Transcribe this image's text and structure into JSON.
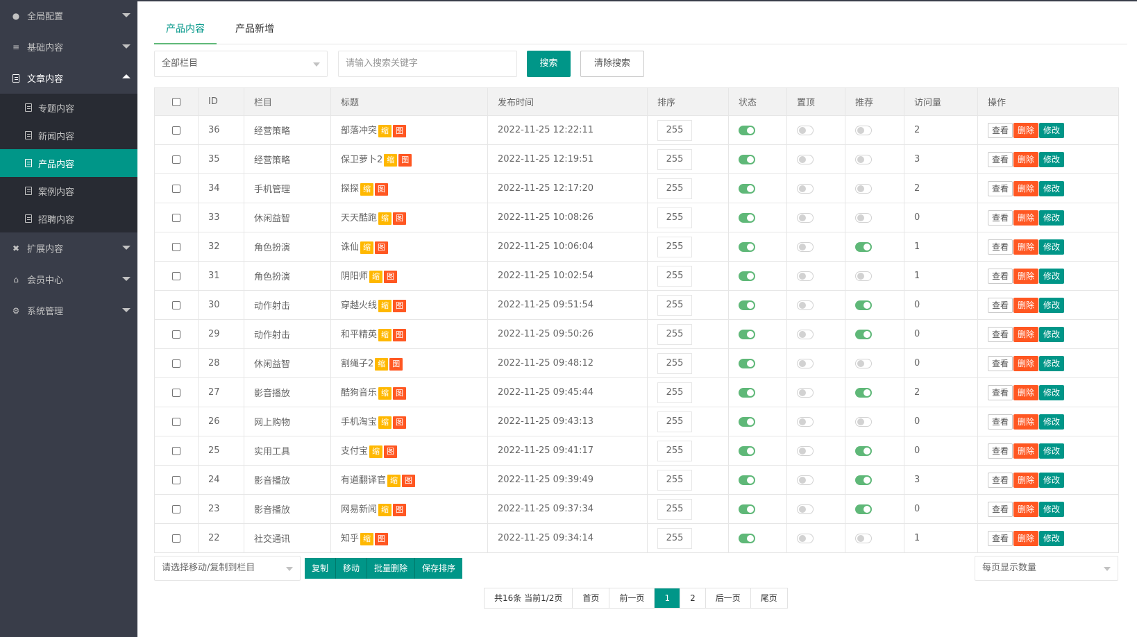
{
  "sidebar": {
    "items": [
      {
        "label": "全局配置",
        "icon": "globe-icon",
        "open": false
      },
      {
        "label": "基础内容",
        "icon": "sliders-icon",
        "open": false
      },
      {
        "label": "文章内容",
        "icon": "document-icon",
        "open": true
      },
      {
        "label": "扩展内容",
        "icon": "puzzle-icon",
        "open": false
      },
      {
        "label": "会员中心",
        "icon": "user-icon",
        "open": false
      },
      {
        "label": "系统管理",
        "icon": "gear-icon",
        "open": false
      }
    ],
    "sub_items": [
      {
        "label": "专题内容",
        "active": false
      },
      {
        "label": "新闻内容",
        "active": false
      },
      {
        "label": "产品内容",
        "active": true
      },
      {
        "label": "案例内容",
        "active": false
      },
      {
        "label": "招聘内容",
        "active": false
      }
    ]
  },
  "tabs": [
    {
      "label": "产品内容",
      "active": true
    },
    {
      "label": "产品新增",
      "active": false
    }
  ],
  "filter": {
    "category_select": "全部栏目",
    "search_placeholder": "请输入搜索关键字",
    "search_button": "搜索",
    "clear_button": "清除搜索"
  },
  "table": {
    "headers": [
      "ID",
      "栏目",
      "标题",
      "发布时间",
      "排序",
      "状态",
      "置顶",
      "推荐",
      "访问量",
      "操作"
    ],
    "tag_thumb": "缩",
    "tag_pic": "图",
    "action_view": "查看",
    "action_delete": "删除",
    "action_edit": "修改",
    "rows": [
      {
        "id": "36",
        "category": "经营策略",
        "title": "部落冲突",
        "time": "2022-11-25 12:22:11",
        "sort": "255",
        "status": true,
        "top": false,
        "recommend": false,
        "views": "2"
      },
      {
        "id": "35",
        "category": "经营策略",
        "title": "保卫萝卜2",
        "time": "2022-11-25 12:19:51",
        "sort": "255",
        "status": true,
        "top": false,
        "recommend": false,
        "views": "3"
      },
      {
        "id": "34",
        "category": "手机管理",
        "title": "探探",
        "time": "2022-11-25 12:17:20",
        "sort": "255",
        "status": true,
        "top": false,
        "recommend": false,
        "views": "2"
      },
      {
        "id": "33",
        "category": "休闲益智",
        "title": "天天酷跑",
        "time": "2022-11-25 10:08:26",
        "sort": "255",
        "status": true,
        "top": false,
        "recommend": false,
        "views": "0"
      },
      {
        "id": "32",
        "category": "角色扮演",
        "title": "诛仙",
        "time": "2022-11-25 10:06:04",
        "sort": "255",
        "status": true,
        "top": false,
        "recommend": true,
        "views": "1"
      },
      {
        "id": "31",
        "category": "角色扮演",
        "title": "阴阳师",
        "time": "2022-11-25 10:02:54",
        "sort": "255",
        "status": true,
        "top": false,
        "recommend": false,
        "views": "1"
      },
      {
        "id": "30",
        "category": "动作射击",
        "title": "穿越火线",
        "time": "2022-11-25 09:51:54",
        "sort": "255",
        "status": true,
        "top": false,
        "recommend": true,
        "views": "0"
      },
      {
        "id": "29",
        "category": "动作射击",
        "title": "和平精英",
        "time": "2022-11-25 09:50:26",
        "sort": "255",
        "status": true,
        "top": false,
        "recommend": true,
        "views": "0"
      },
      {
        "id": "28",
        "category": "休闲益智",
        "title": "割绳子2",
        "time": "2022-11-25 09:48:12",
        "sort": "255",
        "status": true,
        "top": false,
        "recommend": false,
        "views": "0"
      },
      {
        "id": "27",
        "category": "影音播放",
        "title": "酷狗音乐",
        "time": "2022-11-25 09:45:44",
        "sort": "255",
        "status": true,
        "top": false,
        "recommend": true,
        "views": "2"
      },
      {
        "id": "26",
        "category": "网上购物",
        "title": "手机淘宝",
        "time": "2022-11-25 09:43:13",
        "sort": "255",
        "status": true,
        "top": false,
        "recommend": false,
        "views": "0"
      },
      {
        "id": "25",
        "category": "实用工具",
        "title": "支付宝",
        "time": "2022-11-25 09:41:17",
        "sort": "255",
        "status": true,
        "top": false,
        "recommend": true,
        "views": "0"
      },
      {
        "id": "24",
        "category": "影音播放",
        "title": "有道翻译官",
        "time": "2022-11-25 09:39:49",
        "sort": "255",
        "status": true,
        "top": false,
        "recommend": true,
        "views": "3"
      },
      {
        "id": "23",
        "category": "影音播放",
        "title": "网易新闻",
        "time": "2022-11-25 09:37:34",
        "sort": "255",
        "status": true,
        "top": false,
        "recommend": true,
        "views": "0"
      },
      {
        "id": "22",
        "category": "社交通讯",
        "title": "知乎",
        "time": "2022-11-25 09:34:14",
        "sort": "255",
        "status": true,
        "top": false,
        "recommend": false,
        "views": "1"
      }
    ]
  },
  "bottom": {
    "move_select": "请选择移动/复制到栏目",
    "copy": "复制",
    "move": "移动",
    "batch_delete": "批量删除",
    "save_sort": "保存排序",
    "page_size_select": "每页显示数量"
  },
  "pager": {
    "summary": "共16条 当前1/2页",
    "first": "首页",
    "prev": "前一页",
    "pages": [
      "1",
      "2"
    ],
    "current": "1",
    "next": "后一页",
    "last": "尾页"
  },
  "colors": {
    "sidebar_bg": "#393d49",
    "submenu_bg": "#282b33",
    "accent": "#009688",
    "switch_on": "#5fb878",
    "danger": "#ff5722",
    "warning": "#ffb800"
  }
}
